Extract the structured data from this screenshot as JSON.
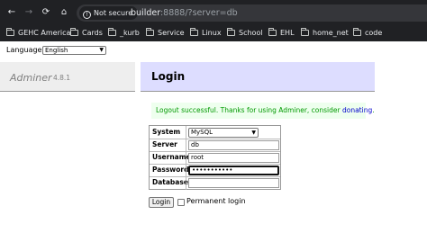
{
  "browser": {
    "nav": {
      "back": "←",
      "forward": "→",
      "reload": "⟳",
      "home": "⌂"
    },
    "security_label": "Not secure",
    "url_host": "builder",
    "url_rest": ":8888/?server=db",
    "bookmarks": [
      {
        "label": "GEHC America"
      },
      {
        "label": "Cards"
      },
      {
        "label": "_kurb"
      },
      {
        "label": "Service"
      },
      {
        "label": "Linux"
      },
      {
        "label": "School"
      },
      {
        "label": "EHL"
      },
      {
        "label": "home_net"
      },
      {
        "label": "code"
      }
    ]
  },
  "language": {
    "label": "Language:",
    "value": "English"
  },
  "sidebar": {
    "brand": "Adminer",
    "version": "4.8.1"
  },
  "main": {
    "title": "Login",
    "message": "Logout successful. Thanks for using Adminer, consider",
    "message_link": "donating",
    "message_end": "."
  },
  "form": {
    "system": {
      "label": "System",
      "value": "MySQL"
    },
    "server": {
      "label": "Server",
      "value": "db"
    },
    "username": {
      "label": "Username",
      "value": "root"
    },
    "password": {
      "label": "Password",
      "value": "•••••••••••"
    },
    "database": {
      "label": "Database",
      "value": ""
    },
    "login_button": "Login",
    "permanent_label": "Permanent login"
  }
}
